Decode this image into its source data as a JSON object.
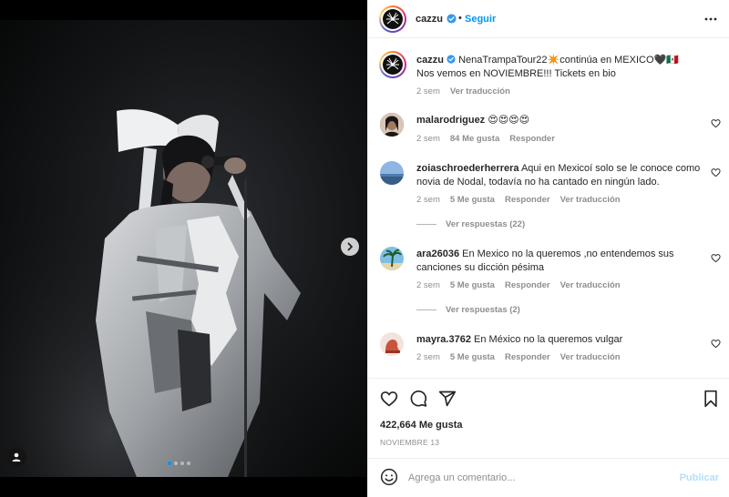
{
  "post": {
    "author": "cazzu",
    "follow_label": "Seguir",
    "caption_text": "NenaTrampaTour22✴️continúa en MEXICO🖤🇲🇽",
    "caption_line2": "Nos vemos en NOVIEMBRE!!! Tickets en bio",
    "caption_time": "2 sem",
    "caption_translate": "Ver traducción",
    "carousel_count": 4,
    "carousel_active": 0
  },
  "comments": [
    {
      "user": "malarodriguez",
      "text": "😍😍😍😍",
      "time": "2 sem",
      "likes": "84 Me gusta",
      "reply": "Responder",
      "translate": "",
      "avatar_color": "#3a2a22"
    },
    {
      "user": "zoiaschroederherrera",
      "text": "Aqui en Mexicoí solo se le conoce como novia de Nodal, todavía no ha cantado en ningún lado.",
      "time": "2 sem",
      "likes": "5 Me gusta",
      "reply": "Responder",
      "translate": "Ver traducción",
      "view_replies": "Ver respuestas (22)",
      "avatar_color": "#6b94c9"
    },
    {
      "user": "ara26036",
      "text": "En Mexico no la queremos ,no entendemos sus canciones su dicción pésima",
      "time": "2 sem",
      "likes": "5 Me gusta",
      "reply": "Responder",
      "translate": "Ver traducción",
      "view_replies": "Ver respuestas (2)",
      "avatar_color": "#3f7fa6"
    },
    {
      "user": "mayra.3762",
      "text": "En México no la queremos vulgar",
      "time": "2 sem",
      "likes": "5 Me gusta",
      "reply": "Responder",
      "translate": "Ver traducción",
      "avatar_color": "#c8553a"
    }
  ],
  "stats": {
    "likes": "422,664 Me gusta",
    "date": "NOVIEMBRE 13"
  },
  "composer": {
    "placeholder": "Agrega un comentario...",
    "publish_label": "Publicar"
  },
  "colors": {
    "accent": "#0095f6",
    "publish_disabled": "#b2dffc",
    "muted": "#8e8e8e"
  },
  "icons": [
    "chevron-right-icon",
    "user-tag-icon",
    "verified-badge-icon",
    "more-icon",
    "heart-outline-icon",
    "comment-icon",
    "share-icon",
    "bookmark-icon",
    "emoji-icon"
  ]
}
